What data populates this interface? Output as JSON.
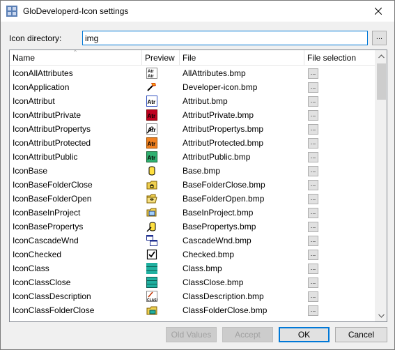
{
  "window": {
    "title": "GloDeveloperd-Icon settings"
  },
  "directory": {
    "label": "Icon directory:",
    "value": "img",
    "browse_label": "..."
  },
  "grid": {
    "columns": [
      "Name",
      "Preview",
      "File",
      "File selection"
    ],
    "rows": [
      {
        "name": "IconAllAttributes",
        "file": "AllAttributes.bmp",
        "icon": "all-attributes-icon"
      },
      {
        "name": "IconApplication",
        "file": "Developer-icon.bmp",
        "icon": "developer-icon"
      },
      {
        "name": "IconAttribut",
        "file": "Attribut.bmp",
        "icon": "attribute-icon"
      },
      {
        "name": "IconAttributPrivate",
        "file": "AttributPrivate.bmp",
        "icon": "attribute-private-icon"
      },
      {
        "name": "IconAttributPropertys",
        "file": "AttributPropertys.bmp",
        "icon": "attribute-properties-icon"
      },
      {
        "name": "IconAttributProtected",
        "file": "AttributProtected.bmp",
        "icon": "attribute-protected-icon"
      },
      {
        "name": "IconAttributPublic",
        "file": "AttributPublic.bmp",
        "icon": "attribute-public-icon"
      },
      {
        "name": "IconBase",
        "file": "Base.bmp",
        "icon": "base-icon"
      },
      {
        "name": "IconBaseFolderClose",
        "file": "BaseFolderClose.bmp",
        "icon": "base-folder-close-icon"
      },
      {
        "name": "IconBaseFolderOpen",
        "file": "BaseFolderOpen.bmp",
        "icon": "base-folder-open-icon"
      },
      {
        "name": "IconBaseInProject",
        "file": "BaseInProject.bmp",
        "icon": "base-in-project-icon"
      },
      {
        "name": "IconBasePropertys",
        "file": "BasePropertys.bmp",
        "icon": "base-properties-icon"
      },
      {
        "name": "IconCascadeWnd",
        "file": "CascadeWnd.bmp",
        "icon": "cascade-window-icon"
      },
      {
        "name": "IconChecked",
        "file": "Checked.bmp",
        "icon": "checked-icon"
      },
      {
        "name": "IconClass",
        "file": "Class.bmp",
        "icon": "class-icon"
      },
      {
        "name": "IconClassClose",
        "file": "ClassClose.bmp",
        "icon": "class-close-icon"
      },
      {
        "name": "IconClassDescription",
        "file": "ClassDescription.bmp",
        "icon": "class-description-icon"
      },
      {
        "name": "IconClassFolderClose",
        "file": "ClassFolderClose.bmp",
        "icon": "class-folder-close-icon"
      }
    ],
    "select_label": "..."
  },
  "buttons": {
    "old_values": "Old Values",
    "accept": "Accept",
    "ok": "OK",
    "cancel": "Cancel"
  }
}
